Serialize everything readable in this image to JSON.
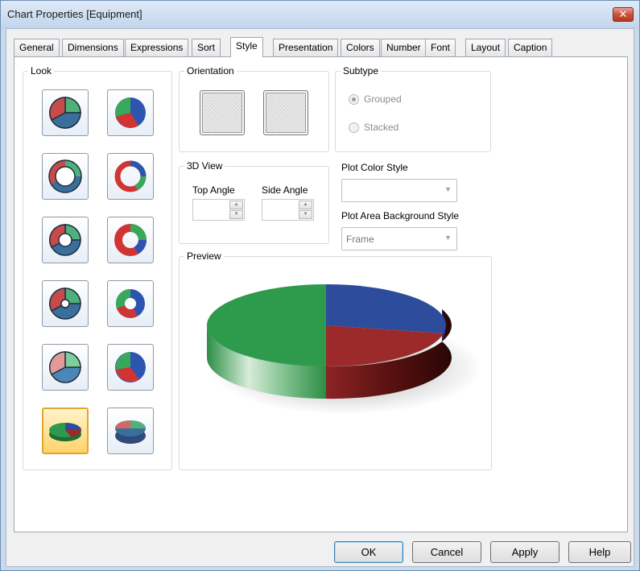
{
  "window": {
    "title": "Chart Properties [Equipment]",
    "close_glyph": "✕"
  },
  "tabs": [
    {
      "label": "General"
    },
    {
      "label": "Dimensions"
    },
    {
      "label": "Expressions"
    },
    {
      "label": "Sort"
    },
    {
      "label": "Style"
    },
    {
      "label": "Presentation"
    },
    {
      "label": "Colors"
    },
    {
      "label": "Number"
    },
    {
      "label": "Font"
    },
    {
      "label": "Layout"
    },
    {
      "label": "Caption"
    }
  ],
  "active_tab": "Style",
  "look": {
    "label": "Look",
    "selected_index": 10,
    "option_count": 12
  },
  "orientation": {
    "label": "Orientation"
  },
  "subtype": {
    "label": "Subtype",
    "options": [
      {
        "label": "Grouped",
        "checked": true
      },
      {
        "label": "Stacked",
        "checked": false
      }
    ],
    "enabled": false
  },
  "view3d": {
    "label": "3D View",
    "top_angle_label": "Top Angle",
    "side_angle_label": "Side Angle",
    "top_angle_value": "",
    "side_angle_value": ""
  },
  "plot_color_style": {
    "label": "Plot Color Style",
    "value": ""
  },
  "plot_area_bg_style": {
    "label": "Plot Area Background Style",
    "value": "Frame"
  },
  "preview": {
    "label": "Preview"
  },
  "buttons": {
    "ok": "OK",
    "cancel": "Cancel",
    "apply": "Apply",
    "help": "Help"
  },
  "colors": {
    "green": "#2e9a4c",
    "red": "#9c2a2a",
    "blue": "#2d4c9c",
    "accent": "#e2a72a"
  }
}
